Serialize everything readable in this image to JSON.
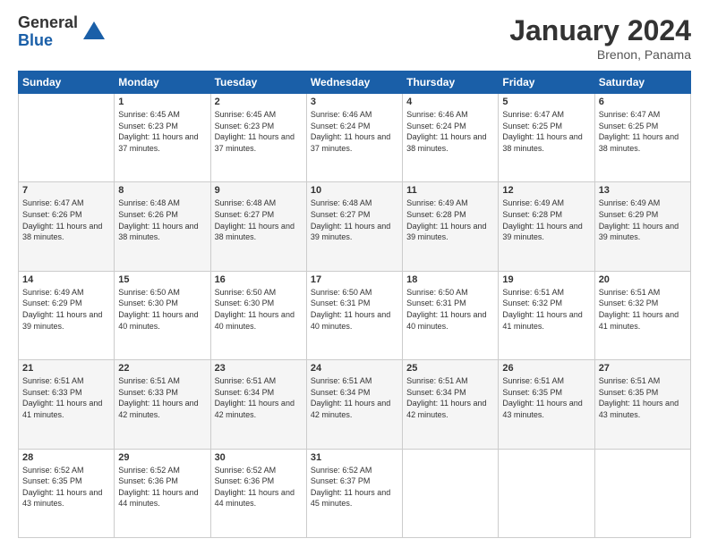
{
  "header": {
    "logo": {
      "general": "General",
      "blue": "Blue"
    },
    "title": "January 2024",
    "location": "Brenon, Panama"
  },
  "calendar": {
    "days_of_week": [
      "Sunday",
      "Monday",
      "Tuesday",
      "Wednesday",
      "Thursday",
      "Friday",
      "Saturday"
    ],
    "weeks": [
      [
        {
          "day": "",
          "info": ""
        },
        {
          "day": "1",
          "info": "Sunrise: 6:45 AM\nSunset: 6:23 PM\nDaylight: 11 hours and 37 minutes."
        },
        {
          "day": "2",
          "info": "Sunrise: 6:45 AM\nSunset: 6:23 PM\nDaylight: 11 hours and 37 minutes."
        },
        {
          "day": "3",
          "info": "Sunrise: 6:46 AM\nSunset: 6:24 PM\nDaylight: 11 hours and 37 minutes."
        },
        {
          "day": "4",
          "info": "Sunrise: 6:46 AM\nSunset: 6:24 PM\nDaylight: 11 hours and 38 minutes."
        },
        {
          "day": "5",
          "info": "Sunrise: 6:47 AM\nSunset: 6:25 PM\nDaylight: 11 hours and 38 minutes."
        },
        {
          "day": "6",
          "info": "Sunrise: 6:47 AM\nSunset: 6:25 PM\nDaylight: 11 hours and 38 minutes."
        }
      ],
      [
        {
          "day": "7",
          "info": "Sunrise: 6:47 AM\nSunset: 6:26 PM\nDaylight: 11 hours and 38 minutes."
        },
        {
          "day": "8",
          "info": "Sunrise: 6:48 AM\nSunset: 6:26 PM\nDaylight: 11 hours and 38 minutes."
        },
        {
          "day": "9",
          "info": "Sunrise: 6:48 AM\nSunset: 6:27 PM\nDaylight: 11 hours and 38 minutes."
        },
        {
          "day": "10",
          "info": "Sunrise: 6:48 AM\nSunset: 6:27 PM\nDaylight: 11 hours and 39 minutes."
        },
        {
          "day": "11",
          "info": "Sunrise: 6:49 AM\nSunset: 6:28 PM\nDaylight: 11 hours and 39 minutes."
        },
        {
          "day": "12",
          "info": "Sunrise: 6:49 AM\nSunset: 6:28 PM\nDaylight: 11 hours and 39 minutes."
        },
        {
          "day": "13",
          "info": "Sunrise: 6:49 AM\nSunset: 6:29 PM\nDaylight: 11 hours and 39 minutes."
        }
      ],
      [
        {
          "day": "14",
          "info": "Sunrise: 6:49 AM\nSunset: 6:29 PM\nDaylight: 11 hours and 39 minutes."
        },
        {
          "day": "15",
          "info": "Sunrise: 6:50 AM\nSunset: 6:30 PM\nDaylight: 11 hours and 40 minutes."
        },
        {
          "day": "16",
          "info": "Sunrise: 6:50 AM\nSunset: 6:30 PM\nDaylight: 11 hours and 40 minutes."
        },
        {
          "day": "17",
          "info": "Sunrise: 6:50 AM\nSunset: 6:31 PM\nDaylight: 11 hours and 40 minutes."
        },
        {
          "day": "18",
          "info": "Sunrise: 6:50 AM\nSunset: 6:31 PM\nDaylight: 11 hours and 40 minutes."
        },
        {
          "day": "19",
          "info": "Sunrise: 6:51 AM\nSunset: 6:32 PM\nDaylight: 11 hours and 41 minutes."
        },
        {
          "day": "20",
          "info": "Sunrise: 6:51 AM\nSunset: 6:32 PM\nDaylight: 11 hours and 41 minutes."
        }
      ],
      [
        {
          "day": "21",
          "info": "Sunrise: 6:51 AM\nSunset: 6:33 PM\nDaylight: 11 hours and 41 minutes."
        },
        {
          "day": "22",
          "info": "Sunrise: 6:51 AM\nSunset: 6:33 PM\nDaylight: 11 hours and 42 minutes."
        },
        {
          "day": "23",
          "info": "Sunrise: 6:51 AM\nSunset: 6:34 PM\nDaylight: 11 hours and 42 minutes."
        },
        {
          "day": "24",
          "info": "Sunrise: 6:51 AM\nSunset: 6:34 PM\nDaylight: 11 hours and 42 minutes."
        },
        {
          "day": "25",
          "info": "Sunrise: 6:51 AM\nSunset: 6:34 PM\nDaylight: 11 hours and 42 minutes."
        },
        {
          "day": "26",
          "info": "Sunrise: 6:51 AM\nSunset: 6:35 PM\nDaylight: 11 hours and 43 minutes."
        },
        {
          "day": "27",
          "info": "Sunrise: 6:51 AM\nSunset: 6:35 PM\nDaylight: 11 hours and 43 minutes."
        }
      ],
      [
        {
          "day": "28",
          "info": "Sunrise: 6:52 AM\nSunset: 6:35 PM\nDaylight: 11 hours and 43 minutes."
        },
        {
          "day": "29",
          "info": "Sunrise: 6:52 AM\nSunset: 6:36 PM\nDaylight: 11 hours and 44 minutes."
        },
        {
          "day": "30",
          "info": "Sunrise: 6:52 AM\nSunset: 6:36 PM\nDaylight: 11 hours and 44 minutes."
        },
        {
          "day": "31",
          "info": "Sunrise: 6:52 AM\nSunset: 6:37 PM\nDaylight: 11 hours and 45 minutes."
        },
        {
          "day": "",
          "info": ""
        },
        {
          "day": "",
          "info": ""
        },
        {
          "day": "",
          "info": ""
        }
      ]
    ]
  }
}
